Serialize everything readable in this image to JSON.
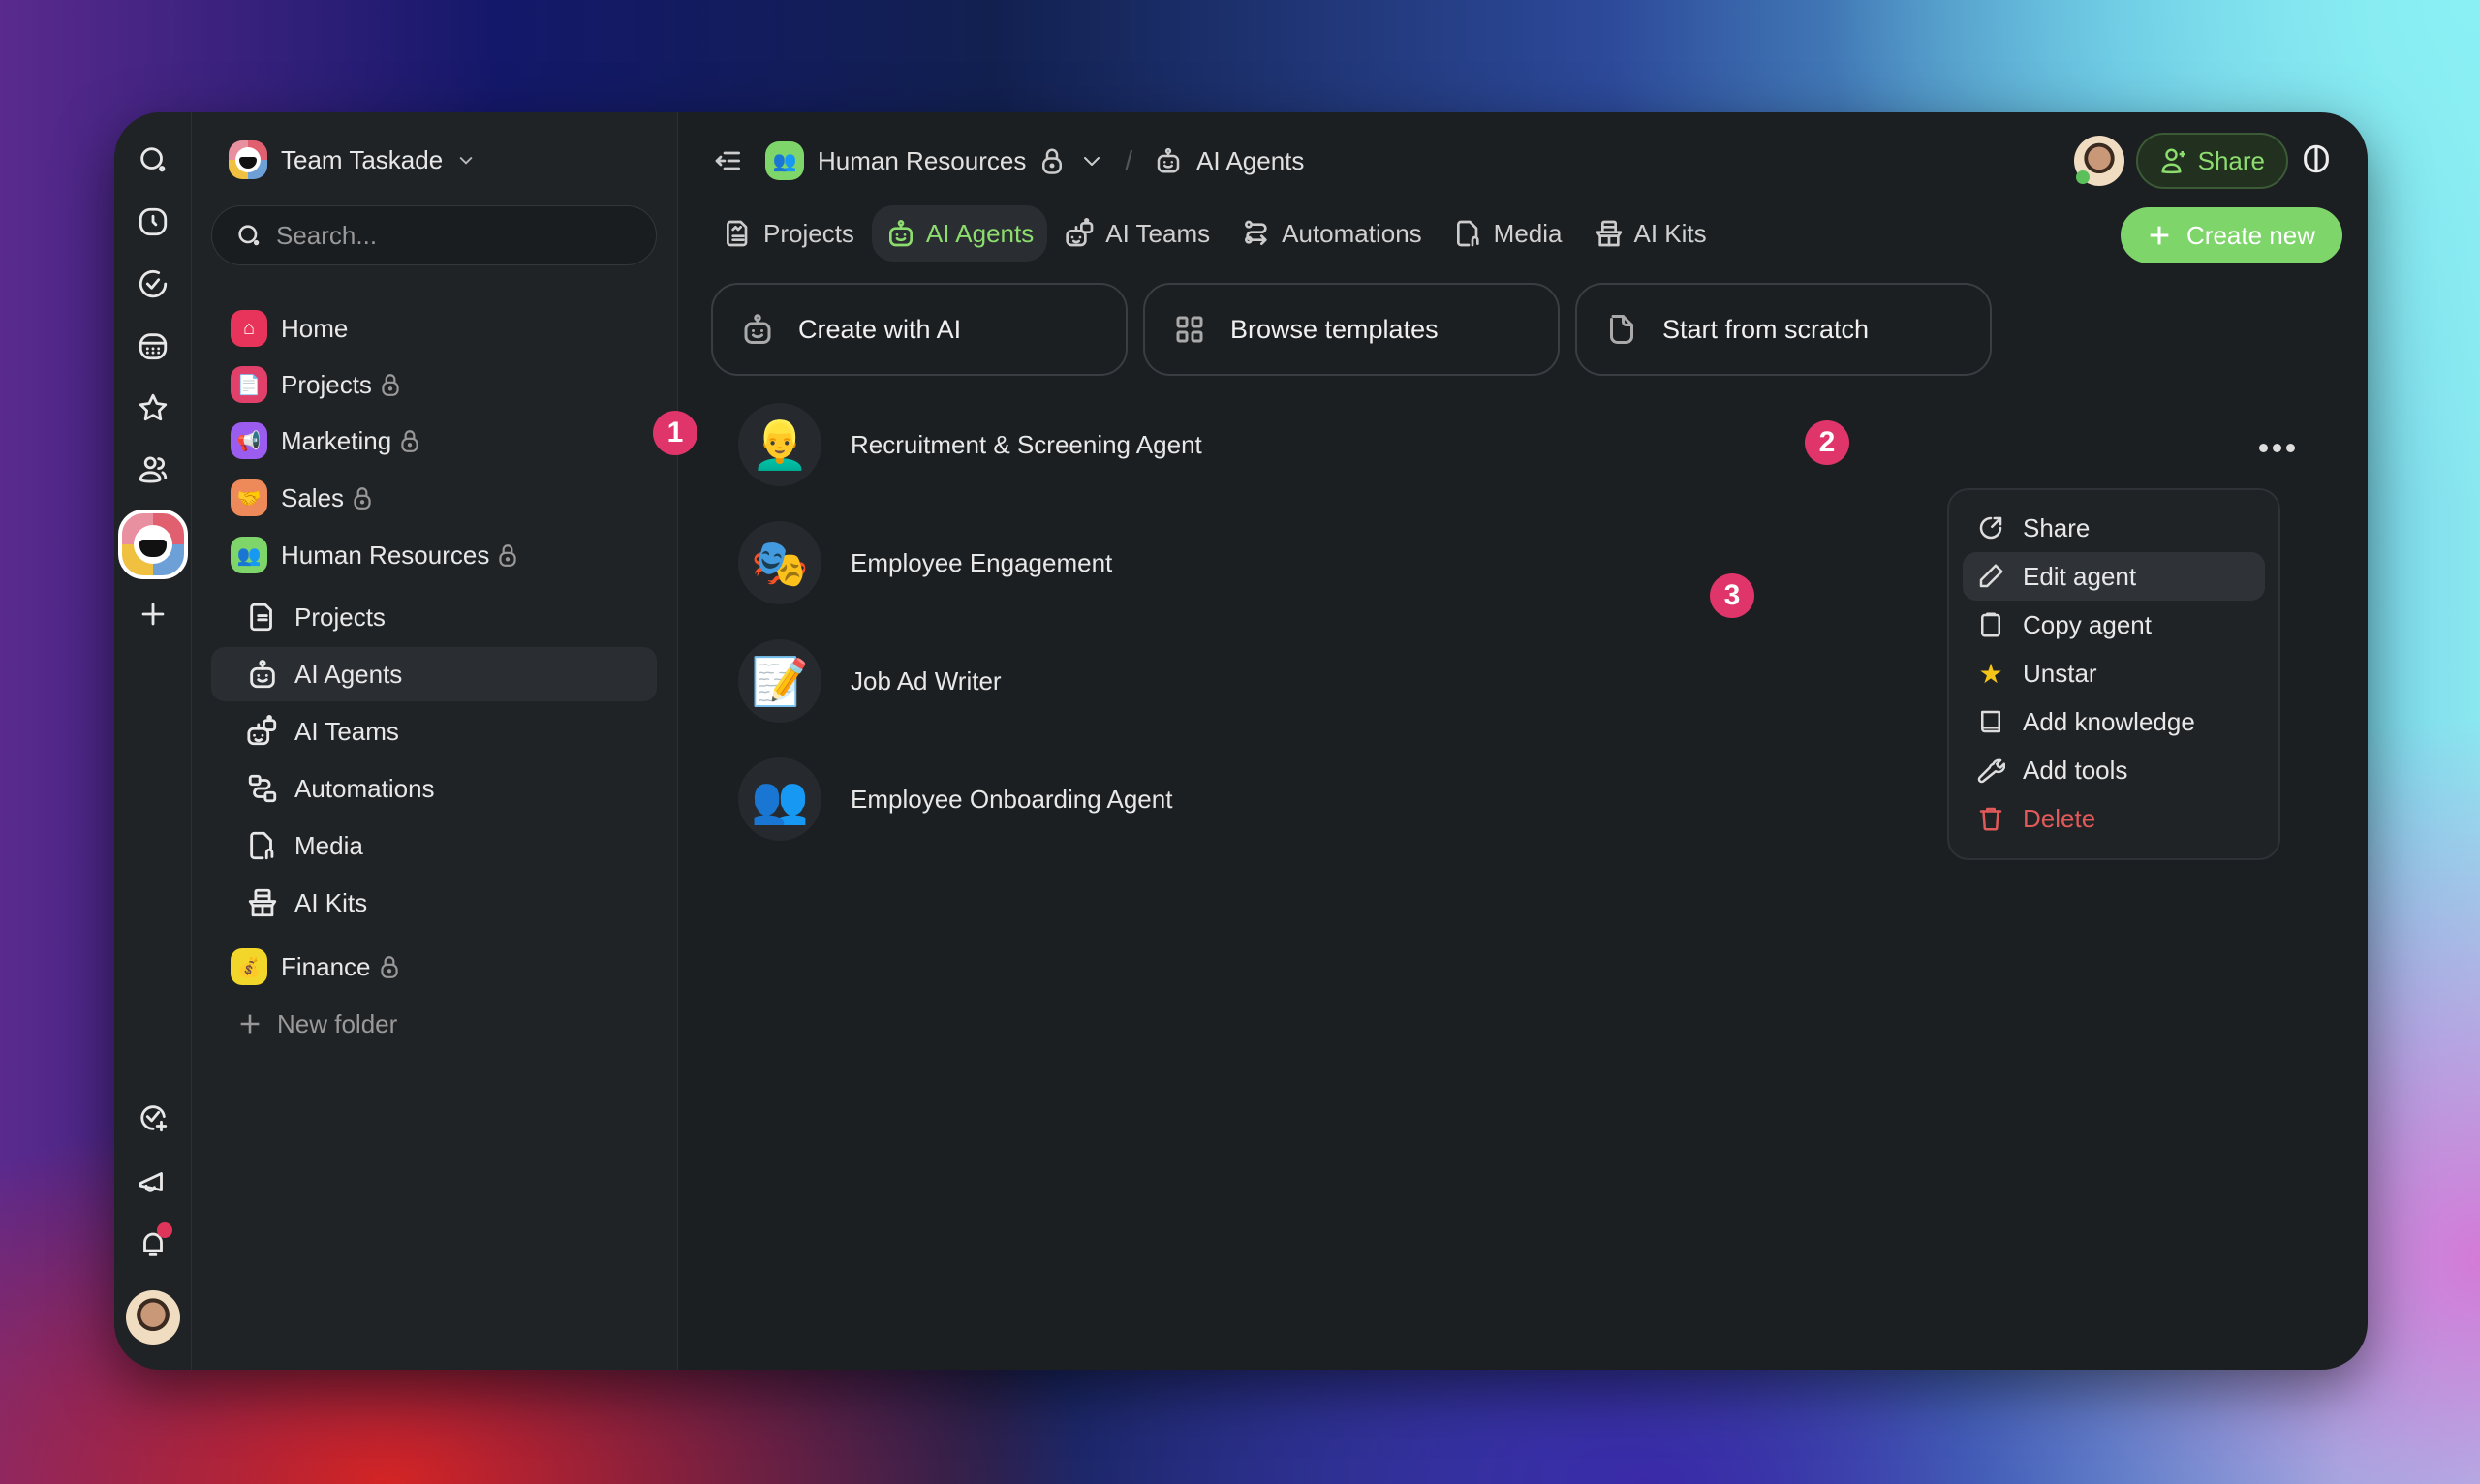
{
  "rail": {
    "icons": [
      "search-icon",
      "clock-icon",
      "check-circle-icon",
      "calendar-icon",
      "star-icon",
      "people-icon"
    ],
    "add_label": "+"
  },
  "sidebar": {
    "team_name": "Team Taskade",
    "search_placeholder": "Search...",
    "folders": [
      {
        "label": "Home",
        "color": "#e8345a",
        "emoji": "⌂",
        "locked": false
      },
      {
        "label": "Projects",
        "color": "#e0406a",
        "emoji": "📄",
        "locked": true
      },
      {
        "label": "Marketing",
        "color": "#9b5cf0",
        "emoji": "📢",
        "locked": true
      },
      {
        "label": "Sales",
        "color": "#ee8a5a",
        "emoji": "🤝",
        "locked": true
      },
      {
        "label": "Human Resources",
        "color": "#7ed56a",
        "emoji": "👥",
        "locked": true
      }
    ],
    "hr_children": [
      {
        "label": "Projects",
        "active": false
      },
      {
        "label": "AI Agents",
        "active": true
      },
      {
        "label": "AI Teams",
        "active": false
      },
      {
        "label": "Automations",
        "active": false
      },
      {
        "label": "Media",
        "active": false
      },
      {
        "label": "AI Kits",
        "active": false
      }
    ],
    "finance": {
      "label": "Finance",
      "color": "#f2d62a",
      "emoji": "💰"
    },
    "new_folder": "New folder"
  },
  "header": {
    "breadcrumb": {
      "workspace": "Human Resources",
      "workspace_emoji": "👥",
      "page": "AI Agents",
      "separator": "/"
    },
    "share_label": "Share"
  },
  "tabs": [
    {
      "label": "Projects",
      "active": false
    },
    {
      "label": "AI Agents",
      "active": true
    },
    {
      "label": "AI Teams",
      "active": false
    },
    {
      "label": "Automations",
      "active": false
    },
    {
      "label": "Media",
      "active": false
    },
    {
      "label": "AI Kits",
      "active": false
    }
  ],
  "create_new_label": "Create new",
  "action_cards": [
    {
      "label": "Create with AI"
    },
    {
      "label": "Browse templates"
    },
    {
      "label": "Start from scratch"
    }
  ],
  "agents": [
    {
      "name": "Recruitment & Screening Agent",
      "emoji": "👱‍♂️"
    },
    {
      "name": "Employee Engagement",
      "emoji": "🎭"
    },
    {
      "name": "Job Ad Writer",
      "emoji": "📝"
    },
    {
      "name": "Employee Onboarding Agent",
      "emoji": "👥"
    }
  ],
  "context_menu": {
    "items": [
      {
        "label": "Share",
        "icon": "share-icon"
      },
      {
        "label": "Edit agent",
        "icon": "pencil-icon",
        "highlighted": true
      },
      {
        "label": "Copy agent",
        "icon": "clipboard-icon"
      },
      {
        "label": "Unstar",
        "icon": "star-filled-icon"
      },
      {
        "label": "Add knowledge",
        "icon": "book-icon"
      },
      {
        "label": "Add tools",
        "icon": "wrench-icon"
      },
      {
        "label": "Delete",
        "icon": "trash-icon",
        "danger": true
      }
    ]
  },
  "step_badges": [
    "1",
    "2",
    "3"
  ],
  "colors": {
    "accent": "#7ed56a",
    "step_badge": "#e0356a",
    "danger": "#e05a5a"
  }
}
